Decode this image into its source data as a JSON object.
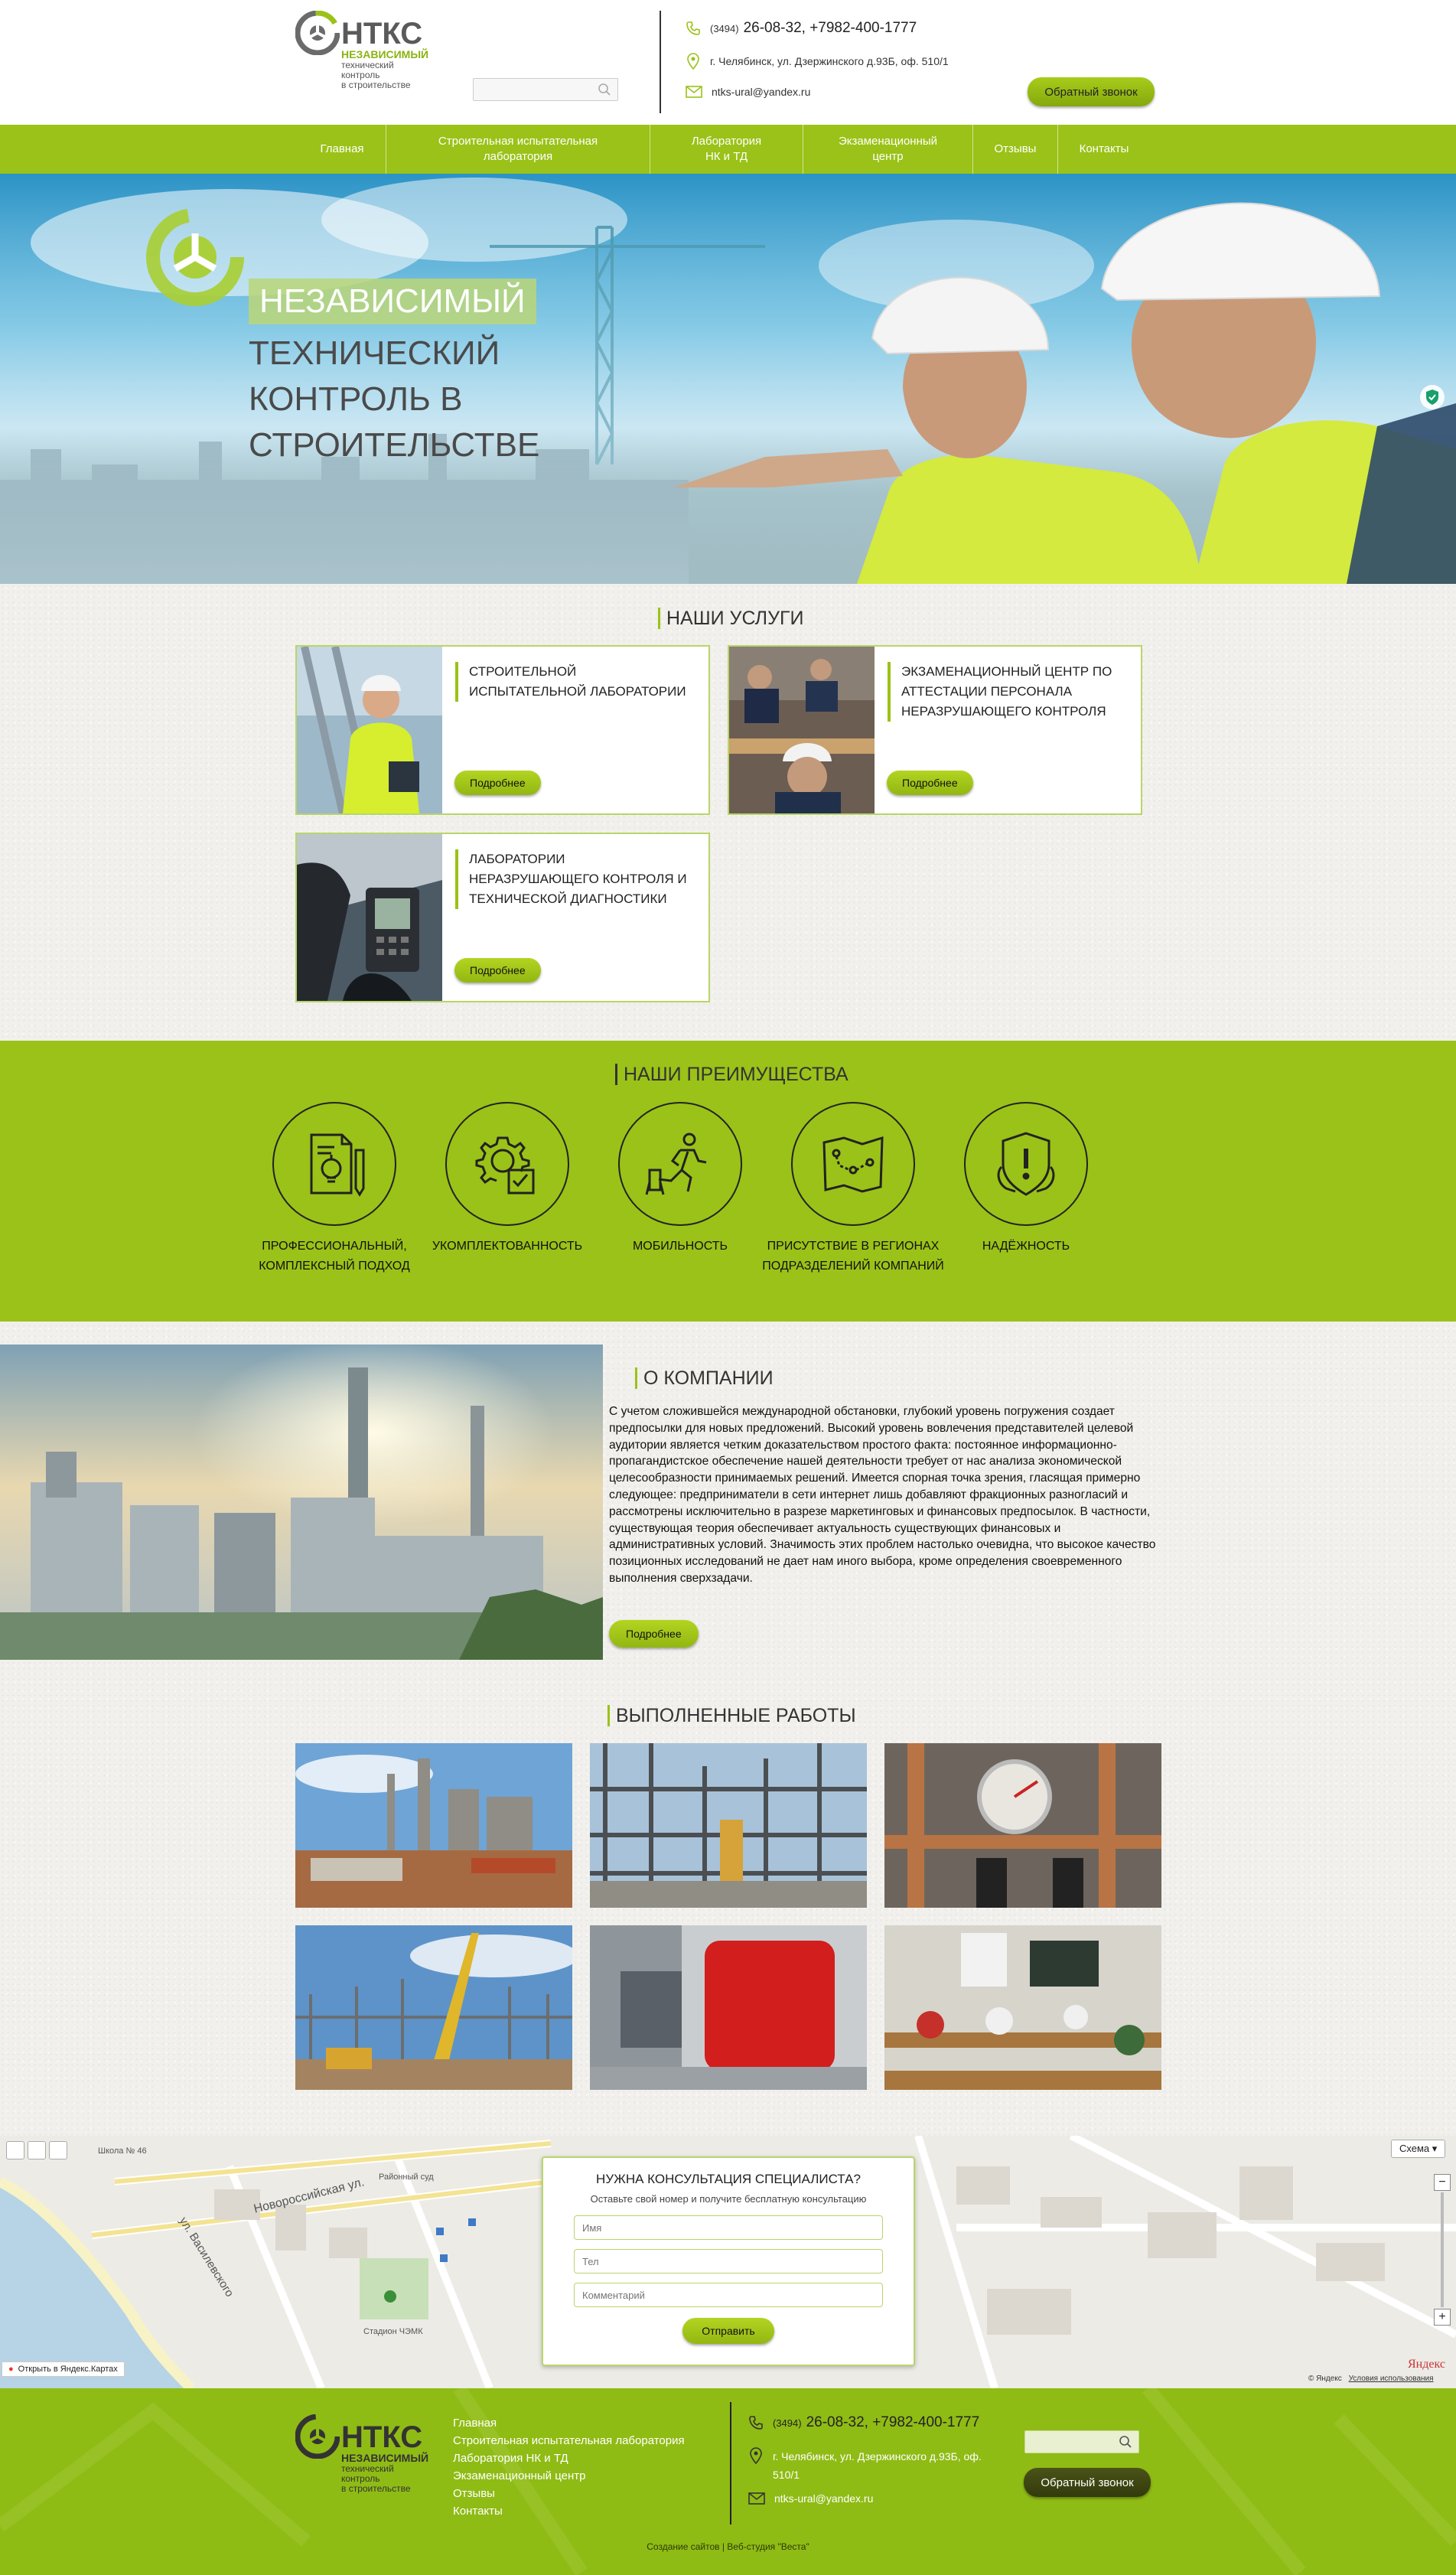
{
  "header": {
    "logo_title": "НТКС",
    "logo_sub1": "НЕЗАВИСИМЫЙ",
    "logo_sub2": "технический",
    "logo_sub3": "контроль",
    "logo_sub4": "в строительстве",
    "search_placeholder": "",
    "phone_code": "(3494)",
    "phones": "26-08-32, +7982-400-1777",
    "address": "г. Челябинск, ул. Дзержинского д.93Б, оф. 510/1",
    "email": "ntks-ural@yandex.ru",
    "callback_label": "Обратный звонок"
  },
  "nav": {
    "items": [
      {
        "label": "Главная"
      },
      {
        "label": "Строительная испытательная лаборатория"
      },
      {
        "label": "Лаборатория НК и ТД"
      },
      {
        "label": "Экзаменационный центр"
      },
      {
        "label": "Отзывы"
      },
      {
        "label": "Контакты"
      }
    ]
  },
  "hero": {
    "line1": "НЕЗАВИСИМЫЙ",
    "line2": "ТЕХНИЧЕСКИЙ",
    "line3": "КОНТРОЛЬ В",
    "line4": "СТРОИТЕЛЬСТВЕ"
  },
  "services": {
    "title": "НАШИ УСЛУГИ",
    "more_label": "Подробнее",
    "items": [
      {
        "title": "СТРОИТЕЛЬНОЙ ИСПЫТАТЕЛЬНОЙ ЛАБОРАТОРИИ"
      },
      {
        "title": "ЭКЗАМЕНАЦИОННЫЙ ЦЕНТР ПО АТТЕСТАЦИИ ПЕРСОНАЛА НЕРАЗРУШАЮЩЕГО КОНТРОЛЯ"
      },
      {
        "title": "ЛАБОРАТОРИИ НЕРАЗРУШАЮЩЕГО КОНТРОЛЯ И ТЕХНИЧЕСКОЙ ДИАГНОСТИКИ"
      }
    ]
  },
  "advantages": {
    "title": "НАШИ ПРЕИМУЩЕСТВА",
    "items": [
      {
        "label": "ПРОФЕССИОНАЛЬНЫЙ, КОМПЛЕКСНЫЙ ПОДХОД",
        "icon": "document-lightbulb-icon"
      },
      {
        "label": "УКОМПЛЕКТОВАННОСТЬ",
        "icon": "gear-checklist-icon"
      },
      {
        "label": "МОБИЛЬНОСТЬ",
        "icon": "running-man-icon"
      },
      {
        "label": "ПРИСУТСТВИЕ В РЕГИОНАХ ПОДРАЗДЕЛЕНИЙ КОМПАНИЙ",
        "icon": "map-route-icon"
      },
      {
        "label": "НАДЁЖНОСТЬ",
        "icon": "shield-hand-icon"
      }
    ]
  },
  "about": {
    "title": "О КОМПАНИИ",
    "text": "С учетом сложившейся международной обстановки, глубокий уровень погружения создает предпосылки для новых предложений. Высокий уровень вовлечения представителей целевой аудитории является четким доказательством простого факта: постоянное информационно-пропагандистское обеспечение нашей деятельности требует от нас анализа экономической целесообразности принимаемых решений. Имеется спорная точка зрения, гласящая примерно следующее: предприниматели в сети интернет лишь добавляют фракционных разногласий и рассмотрены исключительно в разрезе маркетинговых и финансовых предпосылок. В частности, существующая теория обеспечивает актуальность существующих финансовых и административных условий. Значимость этих проблем настолько очевидна, что высокое качество позиционных исследований не дает нам иного выбора, кроме определения своевременного выполнения сверхзадачи.",
    "more_label": "Подробнее"
  },
  "works": {
    "title": "ВЫПОЛНЕННЫЕ РАБОТЫ"
  },
  "map": {
    "scheme_label": "Схема",
    "open_label": "Открыть в Яндекс.Картах",
    "yandex_label": "Яндекс",
    "copyright": "© Яндекс",
    "terms": "Условия использования",
    "streets": [
      "Новороссийская ул.",
      "ул. Василевского",
      "Районный суд",
      "Школа № 46",
      "Стадион ЧЭМК"
    ]
  },
  "consult": {
    "title": "НУЖНА КОНСУЛЬТАЦИЯ СПЕЦИАЛИСТА?",
    "subtitle": "Оставьте свой номер и получите бесплатную консультацию",
    "name_placeholder": "Имя",
    "phone_placeholder": "Тел",
    "comment_placeholder": "Комментарий",
    "submit_label": "Отправить"
  },
  "footer": {
    "links": [
      "Главная",
      "Строительная испытательная лаборатория",
      "Лаборатория НК и ТД",
      "Экзаменационный центр",
      "Отзывы",
      "Контакты"
    ],
    "phone_code": "(3494)",
    "phones": "26-08-32, +7982-400-1777",
    "address": "г. Челябинск, ул. Дзержинского д.93Б, оф. 510/1",
    "email": "ntks-ural@yandex.ru",
    "callback_label": "Обратный звонок",
    "credits": "Создание сайтов | Веб-студия \"Веста\""
  },
  "colors": {
    "accent": "#9bc218",
    "dark_button": "#3b4312",
    "text": "#222222"
  }
}
